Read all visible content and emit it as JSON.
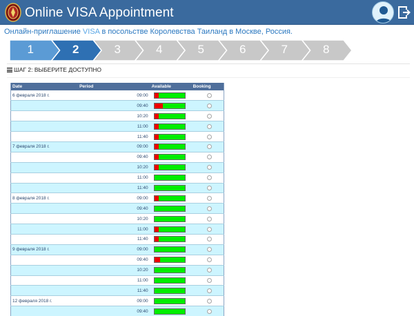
{
  "header": {
    "title": "Online VISA Appointment",
    "emblem_icon": "thai-emblem-icon",
    "avatar_icon": "user-avatar-icon",
    "logout_icon": "logout-icon",
    "color": "#3a6a9e"
  },
  "subtitle": {
    "before": "Онлайн-приглашение ",
    "visa": "VISA",
    "after": " в посольстве Королевства Таиланд в Москве, Россия."
  },
  "steps": {
    "items": [
      "1",
      "2",
      "3",
      "4",
      "5",
      "6",
      "7",
      "8"
    ],
    "current": 2,
    "colors": {
      "done": "#5b9bd5",
      "current": "#2e70b3",
      "pending": "#c8c8c8"
    }
  },
  "section_title": "ШАГ 2: ВЫБЕРИТЕ ДОСТУПНО",
  "table": {
    "headers": {
      "date": "Date",
      "period": "Period",
      "available": "Available",
      "booking": "Booking"
    },
    "rows": [
      {
        "date": "6 февраля 2018 г.",
        "period": "09:00",
        "booked": 0.15
      },
      {
        "date": "",
        "period": "09:40",
        "booked": 0.28
      },
      {
        "date": "",
        "period": "10:20",
        "booked": 0.15
      },
      {
        "date": "",
        "period": "11:00",
        "booked": 0.15
      },
      {
        "date": "",
        "period": "11:40",
        "booked": 0.15
      },
      {
        "date": "7 февраля 2018 г.",
        "period": "09:00",
        "booked": 0.15
      },
      {
        "date": "",
        "period": "09:40",
        "booked": 0.15
      },
      {
        "date": "",
        "period": "10:20",
        "booked": 0.15
      },
      {
        "date": "",
        "period": "11:00",
        "booked": 0
      },
      {
        "date": "",
        "period": "11:40",
        "booked": 0
      },
      {
        "date": "8 февраля 2018 г.",
        "period": "09:00",
        "booked": 0.15
      },
      {
        "date": "",
        "period": "09:40",
        "booked": 0
      },
      {
        "date": "",
        "period": "10:20",
        "booked": 0
      },
      {
        "date": "",
        "period": "11:00",
        "booked": 0.15
      },
      {
        "date": "",
        "period": "11:40",
        "booked": 0.15
      },
      {
        "date": "9 февраля 2018 г.",
        "period": "09:00",
        "booked": 0
      },
      {
        "date": "",
        "period": "09:40",
        "booked": 0.2
      },
      {
        "date": "",
        "period": "10:20",
        "booked": 0
      },
      {
        "date": "",
        "period": "11:00",
        "booked": 0
      },
      {
        "date": "",
        "period": "11:40",
        "booked": 0
      },
      {
        "date": "12 февраля 2018 г.",
        "period": "09:00",
        "booked": 0
      },
      {
        "date": "",
        "period": "09:40",
        "booked": 0
      }
    ]
  }
}
